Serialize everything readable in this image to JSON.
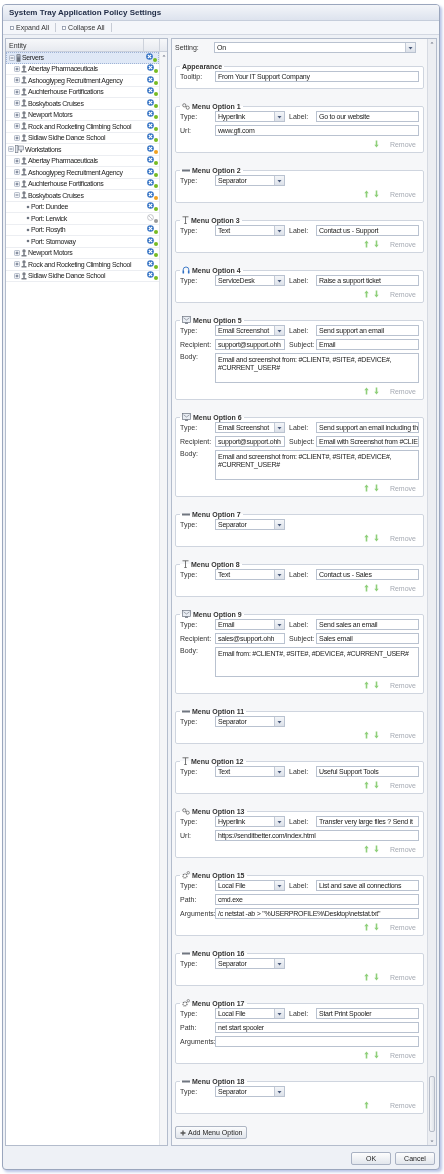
{
  "window": {
    "title": "System Tray Application Policy Settings"
  },
  "toolbar": [
    {
      "label": "Expand All"
    },
    {
      "label": "Collapse All"
    }
  ],
  "tree": {
    "columns": [
      "Entity"
    ],
    "items": [
      {
        "label": "Servers",
        "kind": "servers",
        "expanded": true,
        "selected": true,
        "policy": true,
        "color": "#77bb22",
        "children": [
          {
            "label": "Abertay Pharmaceuticals",
            "kind": "client",
            "expanded": false,
            "selected": false,
            "policy": true,
            "color": "#77bb22"
          },
          {
            "label": "Ashooglypeg Recruitment Agency",
            "kind": "client",
            "expanded": false,
            "selected": false,
            "policy": true,
            "color": "#77bb22"
          },
          {
            "label": "Auchterhouse Fortifications",
            "kind": "client",
            "expanded": false,
            "selected": false,
            "policy": true,
            "color": "#77bb22"
          },
          {
            "label": "Boskyboats Cruises",
            "kind": "client",
            "expanded": false,
            "selected": false,
            "policy": true,
            "color": "#77bb22"
          },
          {
            "label": "Newport Motors",
            "kind": "client",
            "expanded": false,
            "selected": false,
            "policy": true,
            "color": "#77bb22"
          },
          {
            "label": "Rock and Rocketing Climbing School",
            "kind": "client",
            "expanded": false,
            "selected": false,
            "policy": true,
            "color": "#77bb22"
          },
          {
            "label": "Sidlaw Sidhe Dance School",
            "kind": "client",
            "expanded": false,
            "selected": false,
            "policy": true,
            "color": "#77bb22"
          }
        ]
      },
      {
        "label": "Workstations",
        "kind": "workstations",
        "expanded": true,
        "selected": false,
        "policy": true,
        "color": "#f0a020",
        "children": [
          {
            "label": "Abertay Pharmaceuticals",
            "kind": "client",
            "expanded": false,
            "selected": false,
            "policy": true,
            "color": "#77bb22"
          },
          {
            "label": "Ashooglypeg Recruitment Agency",
            "kind": "client",
            "expanded": false,
            "selected": false,
            "policy": true,
            "color": "#77bb22"
          },
          {
            "label": "Auchterhouse Fortifications",
            "kind": "client",
            "expanded": false,
            "selected": false,
            "policy": true,
            "color": "#77bb22"
          },
          {
            "label": "Boskyboats Cruises",
            "kind": "client",
            "expanded": true,
            "selected": false,
            "policy": true,
            "color": "#f0a020",
            "children": [
              {
                "label": "Port: Dundee",
                "kind": "site",
                "selected": false,
                "policy": true,
                "color": "#77bb22"
              },
              {
                "label": "Port: Lerwick",
                "kind": "site",
                "selected": false,
                "policy": false,
                "color": "#999999"
              },
              {
                "label": "Port: Rosyth",
                "kind": "site",
                "selected": false,
                "policy": true,
                "color": "#77bb22"
              },
              {
                "label": "Port: Stornoway",
                "kind": "site",
                "selected": false,
                "policy": true,
                "color": "#77bb22"
              }
            ]
          },
          {
            "label": "Newport Motors",
            "kind": "client",
            "expanded": false,
            "selected": false,
            "policy": true,
            "color": "#77bb22"
          },
          {
            "label": "Rock and Rocketing Climbing School",
            "kind": "client",
            "expanded": false,
            "selected": false,
            "policy": true,
            "color": "#77bb22"
          },
          {
            "label": "Sidlaw Sidhe Dance School",
            "kind": "client",
            "expanded": false,
            "selected": false,
            "policy": true,
            "color": "#77bb22"
          }
        ]
      }
    ]
  },
  "setting": {
    "label": "Setting:",
    "value": "On"
  },
  "appearance": {
    "title": "Appearance",
    "label": "Tooltip:",
    "value": "From Your IT Support Company"
  },
  "menu_options": [
    {
      "title": "Menu Option 1",
      "kind": "link",
      "move_up": false,
      "move_down": true,
      "remove": "Remove",
      "rows": [
        {
          "kind": "pair",
          "label": "Type:",
          "value": "Hyperlink",
          "label2": "Label:",
          "value2": "Go to our website"
        },
        {
          "kind": "wide",
          "label": "Url:",
          "value": "www.gfi.com"
        }
      ]
    },
    {
      "title": "Menu Option 2",
      "kind": "separator",
      "move_up": true,
      "move_down": true,
      "remove": "Remove",
      "rows": [
        {
          "kind": "select",
          "label": "Type:",
          "value": "Separator"
        }
      ]
    },
    {
      "title": "Menu Option 3",
      "kind": "text",
      "move_up": true,
      "move_down": true,
      "remove": "Remove",
      "rows": [
        {
          "kind": "pair",
          "label": "Type:",
          "value": "Text",
          "label2": "Label:",
          "value2": "Contact us - Support"
        }
      ]
    },
    {
      "title": "Menu Option 4",
      "kind": "servicedesk",
      "move_up": true,
      "move_down": true,
      "remove": "Remove",
      "rows": [
        {
          "kind": "pair",
          "label": "Type:",
          "value": "ServiceDesk",
          "label2": "Label:",
          "value2": "Raise a support ticket"
        }
      ]
    },
    {
      "title": "Menu Option 5",
      "kind": "email",
      "move_up": true,
      "move_down": true,
      "remove": "Remove",
      "rows": [
        {
          "kind": "pair",
          "label": "Type:",
          "value": "Email Screenshot",
          "label2": "Label:",
          "value2": "Send support an email"
        },
        {
          "kind": "inputs",
          "label": "Recipient:",
          "value": "support@support.ohh",
          "label2": "Subject:",
          "value2": "Email"
        },
        {
          "kind": "area",
          "label": "Body:",
          "value": "Email and screenshot from: #CLIENT#, #SITE#, #DEVICE#, #CURRENT_USER#"
        }
      ]
    },
    {
      "title": "Menu Option 6",
      "kind": "email",
      "move_up": true,
      "move_down": true,
      "remove": "Remove",
      "rows": [
        {
          "kind": "pair",
          "label": "Type:",
          "value": "Email Screenshot",
          "label2": "Label:",
          "value2": "Send support an email including th"
        },
        {
          "kind": "inputs",
          "label": "Recipient:",
          "value": "support@support.ohh",
          "label2": "Subject:",
          "value2": "Email with Screenshot from #CLIE"
        },
        {
          "kind": "area",
          "label": "Body:",
          "value": "Email and screenshot from: #CLIENT#, #SITE#, #DEVICE#, #CURRENT_USER#"
        }
      ]
    },
    {
      "title": "Menu Option 7",
      "kind": "separator",
      "move_up": true,
      "move_down": true,
      "remove": "Remove",
      "rows": [
        {
          "kind": "select",
          "label": "Type:",
          "value": "Separator"
        }
      ]
    },
    {
      "title": "Menu Option 8",
      "kind": "text",
      "move_up": true,
      "move_down": true,
      "remove": "Remove",
      "rows": [
        {
          "kind": "pair",
          "label": "Type:",
          "value": "Text",
          "label2": "Label:",
          "value2": "Contact us - Sales"
        }
      ]
    },
    {
      "title": "Menu Option 9",
      "kind": "email",
      "move_up": true,
      "move_down": true,
      "remove": "Remove",
      "rows": [
        {
          "kind": "pair",
          "label": "Type:",
          "value": "Email",
          "label2": "Label:",
          "value2": "Send sales an email"
        },
        {
          "kind": "inputs",
          "label": "Recipient:",
          "value": "sales@support.ohh",
          "label2": "Subject:",
          "value2": "Sales email"
        },
        {
          "kind": "area",
          "label": "Body:",
          "value": "Email from: #CLIENT#, #SITE#, #DEVICE#, #CURRENT_USER#"
        }
      ]
    },
    {
      "title": "Menu Option 11",
      "kind": "separator",
      "move_up": true,
      "move_down": true,
      "remove": "Remove",
      "rows": [
        {
          "kind": "select",
          "label": "Type:",
          "value": "Separator"
        }
      ]
    },
    {
      "title": "Menu Option 12",
      "kind": "text",
      "move_up": true,
      "move_down": true,
      "remove": "Remove",
      "rows": [
        {
          "kind": "pair",
          "label": "Type:",
          "value": "Text",
          "label2": "Label:",
          "value2": "Useful Support Tools"
        }
      ]
    },
    {
      "title": "Menu Option 13",
      "kind": "link",
      "move_up": true,
      "move_down": true,
      "remove": "Remove",
      "rows": [
        {
          "kind": "pair",
          "label": "Type:",
          "value": "Hyperlink",
          "label2": "Label:",
          "value2": "Transfer very large files ? Send it"
        },
        {
          "kind": "wide",
          "label": "Url:",
          "value": "https://senditbetter.com/index.html"
        }
      ]
    },
    {
      "title": "Menu Option 15",
      "kind": "localfile",
      "move_up": true,
      "move_down": true,
      "remove": "Remove",
      "rows": [
        {
          "kind": "pair",
          "label": "Type:",
          "value": "Local File",
          "label2": "Label:",
          "value2": "List and save all connections"
        },
        {
          "kind": "wide",
          "label": "Path:",
          "value": "cmd.exe"
        },
        {
          "kind": "wide",
          "label": "Arguments:",
          "value": "/c netstat -ab > \"%USERPROFILE%\\Desktop\\netstat.txt\""
        }
      ]
    },
    {
      "title": "Menu Option 16",
      "kind": "separator",
      "move_up": true,
      "move_down": true,
      "remove": "Remove",
      "rows": [
        {
          "kind": "select",
          "label": "Type:",
          "value": "Separator"
        }
      ]
    },
    {
      "title": "Menu Option 17",
      "kind": "localfile",
      "move_up": true,
      "move_down": true,
      "remove": "Remove",
      "rows": [
        {
          "kind": "pair",
          "label": "Type:",
          "value": "Local File",
          "label2": "Label:",
          "value2": "Start Print Spooler"
        },
        {
          "kind": "wide",
          "label": "Path:",
          "value": "net start spooler"
        },
        {
          "kind": "wide",
          "label": "Arguments:"
        }
      ]
    },
    {
      "title": "Menu Option 18",
      "kind": "separator",
      "move_up": true,
      "move_down": false,
      "remove": "Remove",
      "rows": [
        {
          "kind": "select",
          "label": "Type:",
          "value": "Separator"
        }
      ]
    }
  ],
  "add_button": {
    "label": "Add Menu Option"
  },
  "footer": {
    "buttons": [
      "OK",
      "Cancel"
    ]
  }
}
